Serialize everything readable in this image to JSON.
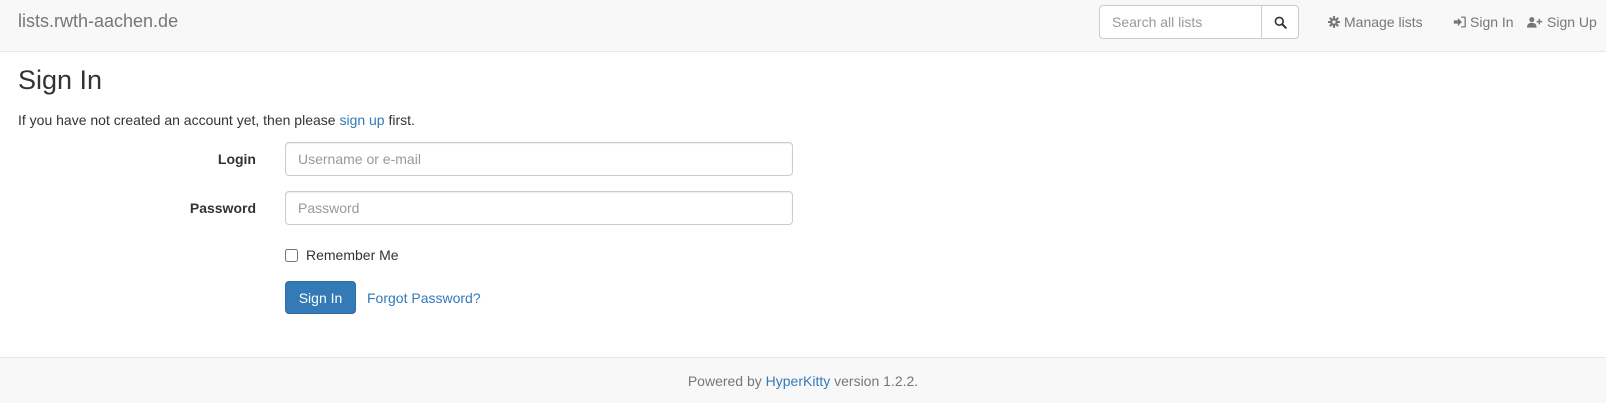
{
  "navbar": {
    "brand": "lists.rwth-aachen.de",
    "search": {
      "placeholder": "Search all lists",
      "icon": "search-icon"
    },
    "links": [
      {
        "label": "Manage lists",
        "icon": "gear-icon"
      },
      {
        "label": "Sign In",
        "icon": "sign-in-icon"
      },
      {
        "label": "Sign Up",
        "icon": "user-plus-icon"
      }
    ]
  },
  "main": {
    "title": "Sign In",
    "intro_before": "If you have not created an account yet, then please ",
    "intro_link": "sign up",
    "intro_after": " first.",
    "form": {
      "login_label": "Login",
      "login_placeholder": "Username or e-mail",
      "password_label": "Password",
      "password_placeholder": "Password",
      "remember_label": "Remember Me",
      "remember_checked": false,
      "submit_label": "Sign In",
      "forgot_label": "Forgot Password?"
    }
  },
  "footer": {
    "before": "Powered by ",
    "link": "HyperKitty",
    "after": " version 1.2.2."
  },
  "colors": {
    "primary": "#337ab7",
    "navbar_bg": "#f8f8f8",
    "muted_text": "#777777"
  }
}
